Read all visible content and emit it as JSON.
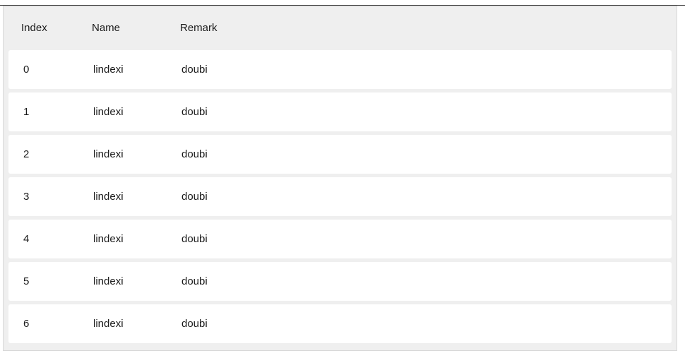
{
  "table": {
    "headers": {
      "index": "Index",
      "name": "Name",
      "remark": "Remark"
    },
    "rows": [
      {
        "index": "0",
        "name": "lindexi",
        "remark": "doubi"
      },
      {
        "index": "1",
        "name": "lindexi",
        "remark": "doubi"
      },
      {
        "index": "2",
        "name": "lindexi",
        "remark": "doubi"
      },
      {
        "index": "3",
        "name": "lindexi",
        "remark": "doubi"
      },
      {
        "index": "4",
        "name": "lindexi",
        "remark": "doubi"
      },
      {
        "index": "5",
        "name": "lindexi",
        "remark": "doubi"
      },
      {
        "index": "6",
        "name": "lindexi",
        "remark": "doubi"
      }
    ]
  },
  "colors": {
    "panel_background": "#efefef",
    "row_background": "#ffffff",
    "text": "#1a1a1a"
  }
}
